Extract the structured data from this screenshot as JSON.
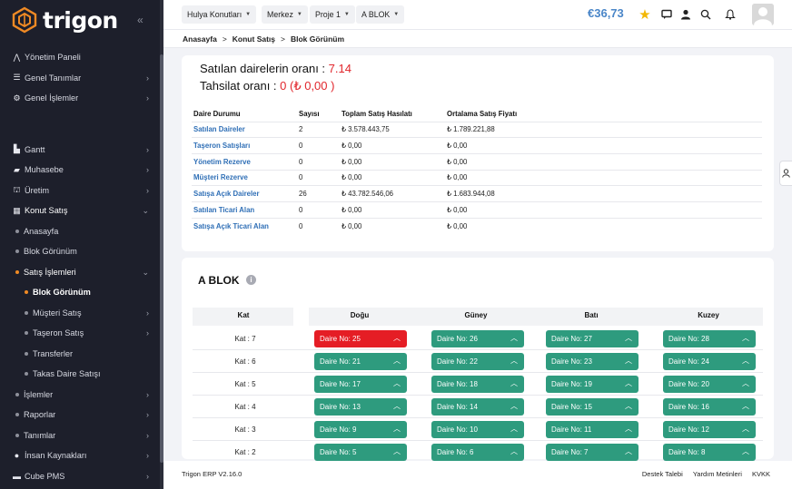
{
  "brand": {
    "name": "trigon"
  },
  "sidebar": {
    "items": [
      {
        "label": "Yönetim Paneli",
        "icon": "chart-line-icon",
        "chevron": false
      },
      {
        "label": "Genel Tanımlar",
        "icon": "sliders-icon",
        "chevron": true
      },
      {
        "label": "Genel İşlemler",
        "icon": "gears-icon",
        "chevron": true
      },
      {
        "label": "Gantt",
        "icon": "gantt-icon",
        "chevron": true
      },
      {
        "label": "Muhasebe",
        "icon": "wallet-icon",
        "chevron": true
      },
      {
        "label": "Üretim",
        "icon": "factory-icon",
        "chevron": true
      },
      {
        "label": "Konut Satış",
        "icon": "building-icon",
        "chevron": true,
        "open": true
      },
      {
        "label": "Anasayfa"
      },
      {
        "label": "Blok Görünüm"
      },
      {
        "label": "Satış İşlemleri",
        "open": true
      },
      {
        "label": "Blok Görünüm",
        "active": true
      },
      {
        "label": "Müşteri Satış"
      },
      {
        "label": "Taşeron Satış"
      },
      {
        "label": "Transferler"
      },
      {
        "label": "Takas Daire Satışı"
      },
      {
        "label": "İşlemler"
      },
      {
        "label": "Raporlar"
      },
      {
        "label": "Tanımlar"
      },
      {
        "label": "İnsan Kaynakları",
        "icon": "user-icon"
      },
      {
        "label": "Cube PMS",
        "icon": "cube-icon"
      }
    ]
  },
  "topbar": {
    "dropdowns": [
      "Hulya Konutları",
      "Merkez",
      "Proje 1",
      "A BLOK"
    ],
    "balance": "€36,73"
  },
  "breadcrumb": [
    "Anasayfa",
    "Konut Satış",
    "Blok Görünüm"
  ],
  "summary": {
    "sold_label": "Satılan dairelerin oranı : ",
    "sold_value": "7.14",
    "collection_label": "Tahsilat oranı : ",
    "collection_value": "0 (₺ 0,00 )",
    "columns": [
      "Daire Durumu",
      "Sayısı",
      "Toplam Satış Hasılatı",
      "Ortalama Satış Fiyatı"
    ],
    "rows": [
      [
        "Satılan Daireler",
        "2",
        "₺ 3.578.443,75",
        "₺ 1.789.221,88"
      ],
      [
        "Taşeron Satışları",
        "0",
        "₺ 0,00",
        "₺ 0,00"
      ],
      [
        "Yönetim Rezerve",
        "0",
        "₺ 0,00",
        "₺ 0,00"
      ],
      [
        "Müşteri Rezerve",
        "0",
        "₺ 0,00",
        "₺ 0,00"
      ],
      [
        "Satışa Açık Daireler",
        "26",
        "₺ 43.782.546,06",
        "₺ 1.683.944,08"
      ],
      [
        "Satılan Ticari Alan",
        "0",
        "₺ 0,00",
        "₺ 0,00"
      ],
      [
        "Satışa Açık Ticari Alan",
        "0",
        "₺ 0,00",
        "₺ 0,00"
      ]
    ]
  },
  "block": {
    "title": "A BLOK",
    "headers": [
      "Kat",
      "Doğu",
      "Güney",
      "Batı",
      "Kuzey"
    ],
    "floors": [
      {
        "kat": "Kat : 7",
        "flats": [
          "Daire No: 25",
          "Daire No: 26",
          "Daire No: 27",
          "Daire No: 28"
        ],
        "sold": [
          true,
          false,
          false,
          false
        ]
      },
      {
        "kat": "Kat : 6",
        "flats": [
          "Daire No: 21",
          "Daire No: 22",
          "Daire No: 23",
          "Daire No: 24"
        ],
        "sold": [
          false,
          false,
          false,
          false
        ]
      },
      {
        "kat": "Kat : 5",
        "flats": [
          "Daire No: 17",
          "Daire No: 18",
          "Daire No: 19",
          "Daire No: 20"
        ],
        "sold": [
          false,
          false,
          false,
          false
        ]
      },
      {
        "kat": "Kat : 4",
        "flats": [
          "Daire No: 13",
          "Daire No: 14",
          "Daire No: 15",
          "Daire No: 16"
        ],
        "sold": [
          false,
          false,
          false,
          false
        ]
      },
      {
        "kat": "Kat : 3",
        "flats": [
          "Daire No: 9",
          "Daire No: 10",
          "Daire No: 11",
          "Daire No: 12"
        ],
        "sold": [
          false,
          false,
          false,
          false
        ]
      },
      {
        "kat": "Kat : 2",
        "flats": [
          "Daire No: 5",
          "Daire No: 6",
          "Daire No: 7",
          "Daire No: 8"
        ],
        "sold": [
          false,
          false,
          false,
          false
        ]
      }
    ]
  },
  "footer": {
    "version": "Trigon ERP V2.16.0",
    "links": [
      "Destek Talebi",
      "Yardım Metinleri",
      "KVKK"
    ]
  },
  "colors": {
    "available": "#2e9b7e",
    "sold": "#e51d25",
    "accent": "#f08a24",
    "link": "#2f6fb6"
  }
}
